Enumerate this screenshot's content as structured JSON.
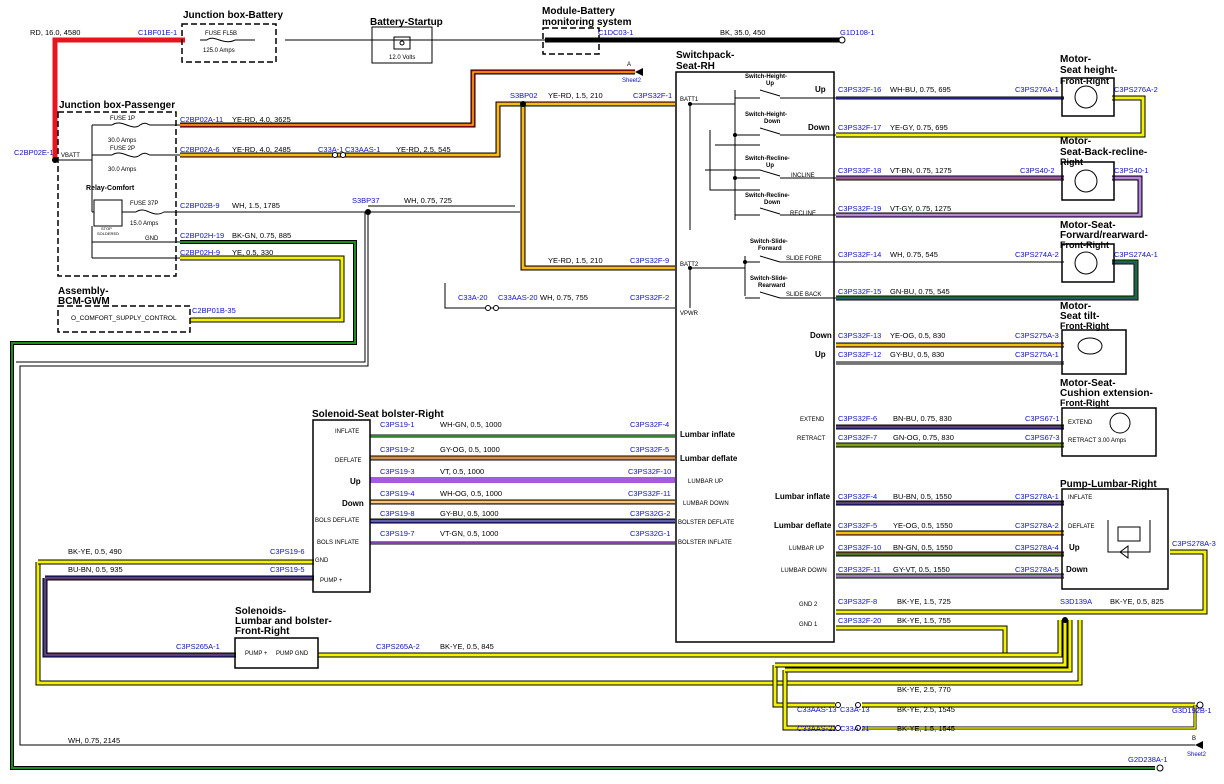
{
  "titles": {
    "junction_battery": "Junction box-Battery",
    "battery_startup": "Battery-Startup",
    "module_battery_1": "Module-Battery",
    "module_battery_2": "monitoring system",
    "junction_passenger": "Junction box-Passenger",
    "relay_comfort": "Relay-Comfort",
    "assembly_bcm_1": "Assembly-",
    "assembly_bcm_2": "BCM-GWM",
    "switchpack_1": "Switchpack-",
    "switchpack_2": "Seat-RH",
    "solenoid_bolster": "Solenoid-Seat bolster-Right",
    "solenoids_lumbar_1": "Solenoids-",
    "solenoids_lumbar_2": "Lumbar and bolster-",
    "solenoids_lumbar_3": "Front-Right",
    "motor_height_1": "Motor-",
    "motor_height_2": "Seat height-",
    "motor_height_3": "Front-Right",
    "motor_recline_1": "Motor-",
    "motor_recline_2": "Seat-Back-recline-",
    "motor_recline_3": "Right",
    "motor_forward_1": "Motor-Seat-",
    "motor_forward_2": "Forward/rearward-",
    "motor_forward_3": "Front-Right",
    "motor_tilt_1": "Motor-",
    "motor_tilt_2": "Seat tilt-",
    "motor_tilt_3": "Front-Right",
    "motor_cushion_1": "Motor-Seat-",
    "motor_cushion_2": "Cushion extension-",
    "motor_cushion_3": "Front-Right",
    "pump_lumbar": "Pump-Lumbar-Right"
  },
  "switches": {
    "height_up_1": "Switch-Height-",
    "height_up_2": "Up",
    "height_down_1": "Switch-Height-",
    "height_down_2": "Down",
    "recline_up_1": "Switch-Recline-",
    "recline_up_2": "Up",
    "recline_down_1": "Switch-Recline-",
    "recline_down_2": "Down",
    "slide_fwd_1": "Switch-Slide-",
    "slide_fwd_2": "Forward",
    "slide_rear_1": "Switch-Slide-",
    "slide_rear_2": "Rearward"
  },
  "fuses": {
    "fl5b": "FUSE FL5B",
    "fl5b_amps": "125.0 Amps",
    "f1p": "FUSE 1P",
    "f1p_amps": "30.0 Amps",
    "f2p": "FUSE 2P",
    "f2p_amps": "30.0 Amps",
    "f37p": "FUSE 37P",
    "f37p_amps": "15.0 Amps",
    "battery_volts": "12.0 Volts",
    "stop_soldered_1": "STOP",
    "stop_soldered_2": "SOLDERED",
    "extend_amps": "RETRACT  3.00 Amps"
  },
  "pins": {
    "vbatt": "VBATT",
    "gnd_jb": "GND",
    "batt1": "BATT1",
    "batt2": "BATT2",
    "vpwr": "VPWR",
    "up": "Up",
    "down": "Down",
    "incline": "INCLINE",
    "recline": "RECLINE",
    "slide_fore": "SLIDE FORE",
    "slide_back": "SLIDE BACK",
    "tilt_down": "Down",
    "tilt_up": "Up",
    "extend": "EXTEND",
    "retract": "RETRACT",
    "cushion_extend": "EXTEND",
    "lumbar_inflate": "Lumbar inflate",
    "lumbar_deflate": "Lumbar deflate",
    "lumbar_up": "LUMBAR UP",
    "lumbar_down": "LUMBAR DOWN",
    "gnd2": "GND 2",
    "gnd1": "GND 1",
    "sp_lumbar_inflate": "Lumbar inflate",
    "sp_lumbar_deflate": "Lumbar deflate",
    "sp_lumbar_up": "LUMBAR UP",
    "sp_lumbar_down": "LUMBAR DOWN",
    "sp_bolster_deflate": "BOLSTER DEFLATE",
    "sp_bolster_inflate": "BOLSTER INFLATE",
    "sol_inflate": "INFLATE",
    "sol_deflate": "DEFLATE",
    "sol_up": "Up",
    "sol_down": "Down",
    "sol_bols_deflate": "BOLS DEFLATE",
    "sol_bols_inflate": "BOLS INFLATE",
    "sol_gnd": "GND",
    "sol_pump": "PUMP +",
    "pump_plus": "PUMP +",
    "pump_gnd": "PUMP GND",
    "pump_inflate": "INFLATE",
    "pump_deflate": "DEFLATE",
    "pump_up": "Up",
    "pump_down": "Down",
    "comfort_supply": "O_COMFORT_SUPPLY_CONTROL"
  },
  "connectors": {
    "c1bf01e1": "C1BF01E-1",
    "c1dc03_1": "C1DC03-1",
    "g1d108_1": "G1D108-1",
    "c2bp02e1": "C2BP02E-1",
    "c2bp02a11": "C2BP02A-11",
    "c2bp02a6": "C2BP02A-6",
    "c2bp02b9": "C2BP02B-9",
    "c2bp02h19": "C2BP02H-19",
    "c2bp02h9": "C2BP02H-9",
    "c2bp01b35": "C2BP01B-35",
    "c33a1": "C33A-1",
    "c33aas1": "C33AAS-1",
    "s3bp02": "S3BP02",
    "s3bp37": "S3BP37",
    "c3ps32f1": "C3PS32F-1",
    "c3ps32f9": "C3PS32F-9",
    "c3ps32f2": "C3PS32F-2",
    "c33a20": "C33A-20",
    "c33aas20": "C33AAS-20",
    "c3ps32f16": "C3PS32F-16",
    "c3ps32f17": "C3PS32F-17",
    "c3ps32f18": "C3PS32F-18",
    "c3ps32f19": "C3PS32F-19",
    "c3ps32f14": "C3PS32F-14",
    "c3ps32f15": "C3PS32F-15",
    "c3ps32f13": "C3PS32F-13",
    "c3ps32f12": "C3PS32F-12",
    "c3ps32f6": "C3PS32F-6",
    "c3ps32f7": "C3PS32F-7",
    "c3ps32f4": "C3PS32F-4",
    "c3ps32f5": "C3PS32F-5",
    "c3ps32f10": "C3PS32F-10",
    "c3ps32f11": "C3PS32F-11",
    "c3ps32f8": "C3PS32F-8",
    "c3ps32f20": "C3PS32F-20",
    "c3ps276a1": "C3PS276A-1",
    "c3ps276a2": "C3PS276A-2",
    "c3ps40_2": "C3PS40-2",
    "c3ps40_1": "C3PS40-1",
    "c3ps274a2": "C3PS274A-2",
    "c3ps274a1": "C3PS274A-1",
    "c3ps275a3": "C3PS275A-3",
    "c3ps275a1": "C3PS275A-1",
    "c3ps67_1": "C3PS67-1",
    "c3ps67_3": "C3PS67-3",
    "c3ps278a1": "C3PS278A-1",
    "c3ps278a2": "C3PS278A-2",
    "c3ps278a4": "C3PS278A-4",
    "c3ps278a5": "C3PS278A-5",
    "c3ps278a3": "C3PS278A-3",
    "c3ps19_1": "C3PS19-1",
    "c3ps19_2": "C3PS19-2",
    "c3ps19_3": "C3PS19-3",
    "c3ps19_4": "C3PS19-4",
    "c3ps19_8": "C3PS19-8",
    "c3ps19_7": "C3PS19-7",
    "c3ps19_6": "C3PS19-6",
    "c3ps19_5": "C3PS19-5",
    "c3ps32f10b": "C3PS32F-10",
    "c3ps32f11b": "C3PS32F-11",
    "c3ps32g2": "C3PS32G-2",
    "c3ps32g1": "C3PS32G-1",
    "c3ps32f4b": "C3PS32F-4",
    "c3ps32f5b": "C3PS32F-5",
    "c3ps265a1": "C3PS265A-1",
    "c3ps265a2": "C3PS265A-2",
    "s3d139a": "S3D139A",
    "c33aas13": "C33AAS-13",
    "c33a13": "C33A-13",
    "c33aas21": "C33AAS-21",
    "c33a21": "C33A-21",
    "g3d192b1": "G3D192B-1",
    "g2d238a1": "G2D238A-1"
  },
  "wires": {
    "rd_16": "RD,  16.0,  4580",
    "bk_35": "BK,  35.0,  450",
    "yerd_4_3625": "YE-RD,  4.0,  3625",
    "yerd_4_2485": "YE-RD,  4.0,  2485",
    "yerd_25_545": "YE-RD,  2.5,  545",
    "yerd_15_210a": "YE-RD,  1.5,  210",
    "yerd_15_210b": "YE-RD,  1.5,  210",
    "wh_15_1785": "WH,  1.5,  1785",
    "wh_075_725": "WH,  0.75,  725",
    "bkgn_075_885": "BK-GN,  0.75,  885",
    "ye_05_330": "YE,  0.5,  330",
    "wh_075_755": "WH,  0.75,  755",
    "whbu_695": "WH-BU,  0.75,  695",
    "yegy_695": "YE-GY,  0.75,  695",
    "vtbn_1275": "VT-BN,  0.75,  1275",
    "vtgy_1275": "VT-GY,  0.75,  1275",
    "wh_545": "WH,  0.75,  545",
    "gnbu_545": "GN-BU,  0.75,  545",
    "yeog_830": "YE-OG,  0.5,  830",
    "gybu_830": "GY-BU,  0.5,  830",
    "bnbu_830": "BN-BU,  0.75,  830",
    "gnog_830": "GN-OG,  0.75,  830",
    "bubn_1550": "BU-BN,  0.5,  1550",
    "yeog_1550": "YE-OG,  0.5,  1550",
    "bngn_1550": "BN-GN,  0.5,  1550",
    "gyvt_1550": "GY-VT,  0.5,  1550",
    "bkye_15_725": "BK-YE,  1.5,  725",
    "bkye_15_755": "BK-YE,  1.5,  755",
    "bkye_05_825": "BK-YE,  0.5,  825",
    "whgn_1000": "WH-GN,  0.5,  1000",
    "gyog_1000": "GY-OG,  0.5,  1000",
    "vt_1000": "VT,  0.5,  1000",
    "whog_1000": "WH-OG,  0.5,  1000",
    "gybu_1000": "GY-BU,  0.5,  1000",
    "vtgn_1000": "VT-GN,  0.5,  1000",
    "bkye_490": "BK-YE,  0.5,  490",
    "bubn_935": "BU-BN,  0.5,  935",
    "bkye_845": "BK-YE,  0.5,  845",
    "bkye_25_770": "BK-YE,  2.5,  770",
    "bkye_25_1545": "BK-YE,  2.5,  1545",
    "bkye_15_1545": "BK-YE,  1.5,  1545",
    "wh_075_2145": "WH,  0.75,  2145"
  },
  "sheet_refs": {
    "a": "A",
    "a_sheet": "Sheet2",
    "b": "B",
    "b_sheet": "Sheet2"
  },
  "colors": {
    "red": "#e8141e",
    "black": "#000000",
    "yellow": "#f2f200",
    "orange": "#f28c1a",
    "blue": "#2b2bb0",
    "green": "#1c8c1c",
    "violet": "#a35ce0",
    "brown": "#8b5a2b",
    "grey": "#9a9a9a",
    "connector_text": "#1010c8"
  }
}
